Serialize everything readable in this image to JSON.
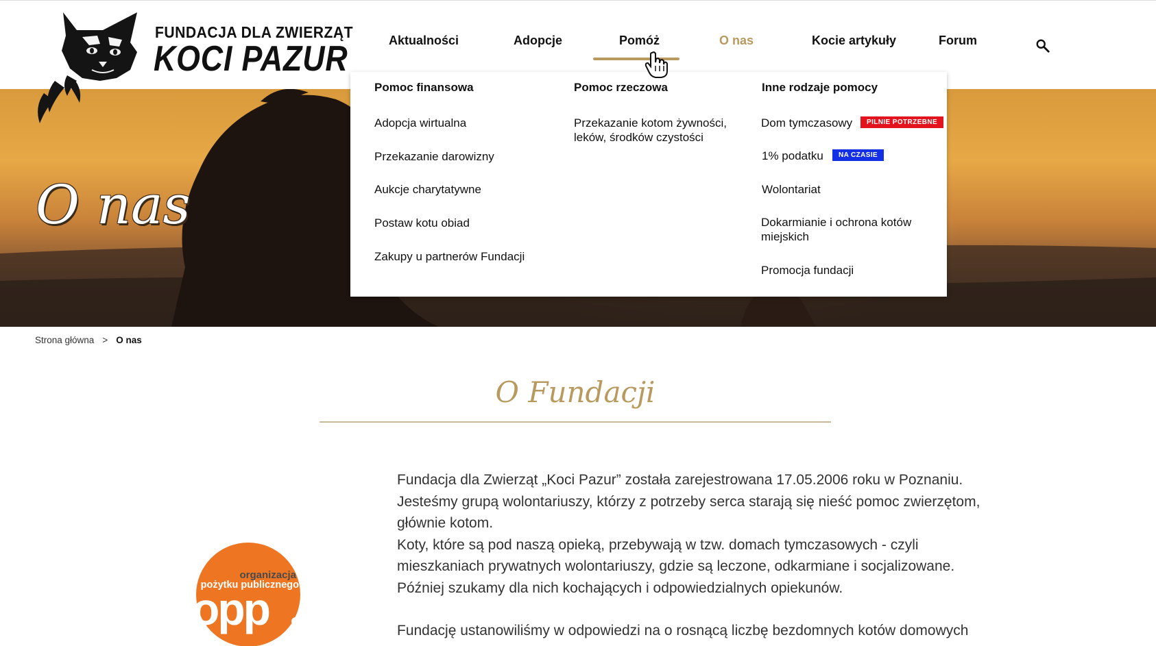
{
  "logo": {
    "line1": "FUNDACJA DLA ZWIERZĄT",
    "line2": "KOCI PAZUR"
  },
  "nav": {
    "items": [
      "Aktualności",
      "Adopcje",
      "Pomóż",
      "O nas",
      "Kocie artykuły",
      "Forum"
    ],
    "active": "O nas",
    "hovered": "Pomóż",
    "search_icon": "search-icon"
  },
  "dropdown": {
    "columns": [
      {
        "heading": "Pomoc finansowa",
        "links": [
          "Adopcja wirtualna",
          "Przekazanie darowizny",
          "Aukcje charytatywne",
          "Postaw kotu obiad",
          "Zakupy u partnerów Fundacji"
        ]
      },
      {
        "heading": "Pomoc rzeczowa",
        "links": [
          "Przekazanie kotom żywności, leków, środków czystości"
        ]
      },
      {
        "heading": "Inne rodzaje pomocy",
        "links": [
          "Dom tymczasowy",
          "1% podatku",
          "Wolontariat",
          "Dokarmianie i ochrona kotów miejskich",
          "Promocja fundacji"
        ],
        "badges": {
          "dom": "PILNIE POTRZEBNE",
          "podatek": "NA CZASIE"
        }
      }
    ]
  },
  "hero": {
    "title": "O nas"
  },
  "breadcrumb": {
    "home": "Strona główna",
    "separator": ">",
    "current": "O nas"
  },
  "section": {
    "title": "O Fundacji"
  },
  "body": {
    "lines": [
      "Fundacja dla Zwierząt „Koci Pazur” została zarejestrowana 17.05.2006 roku w Poznaniu.",
      "Jesteśmy grupą wolontariuszy, którzy z potrzeby serca starają się nieść pomoc zwierzętom,",
      "głównie kotom.",
      "Koty, które są pod naszą opieką, przebywają w tzw. domach tymczasowych - czyli",
      "mieszkaniach prywatnych wolontariuszy, gdzie są leczone, odkarmiane i socjalizowane.",
      "Później szukamy dla nich kochających i odpowiedzialnych opiekunów.",
      "Fundację ustanowiliśmy w odpowiedzi na o rosnącą liczbę bezdomnych kotów domowych"
    ]
  },
  "opp_logo": {
    "text1": "organizacja",
    "text2": "pożytku publicznego",
    "text3": "opp",
    "color": "#ee7623"
  },
  "colors": {
    "accent": "#b89a5f",
    "badge_red": "#e3141e",
    "badge_blue": "#1430e6"
  }
}
